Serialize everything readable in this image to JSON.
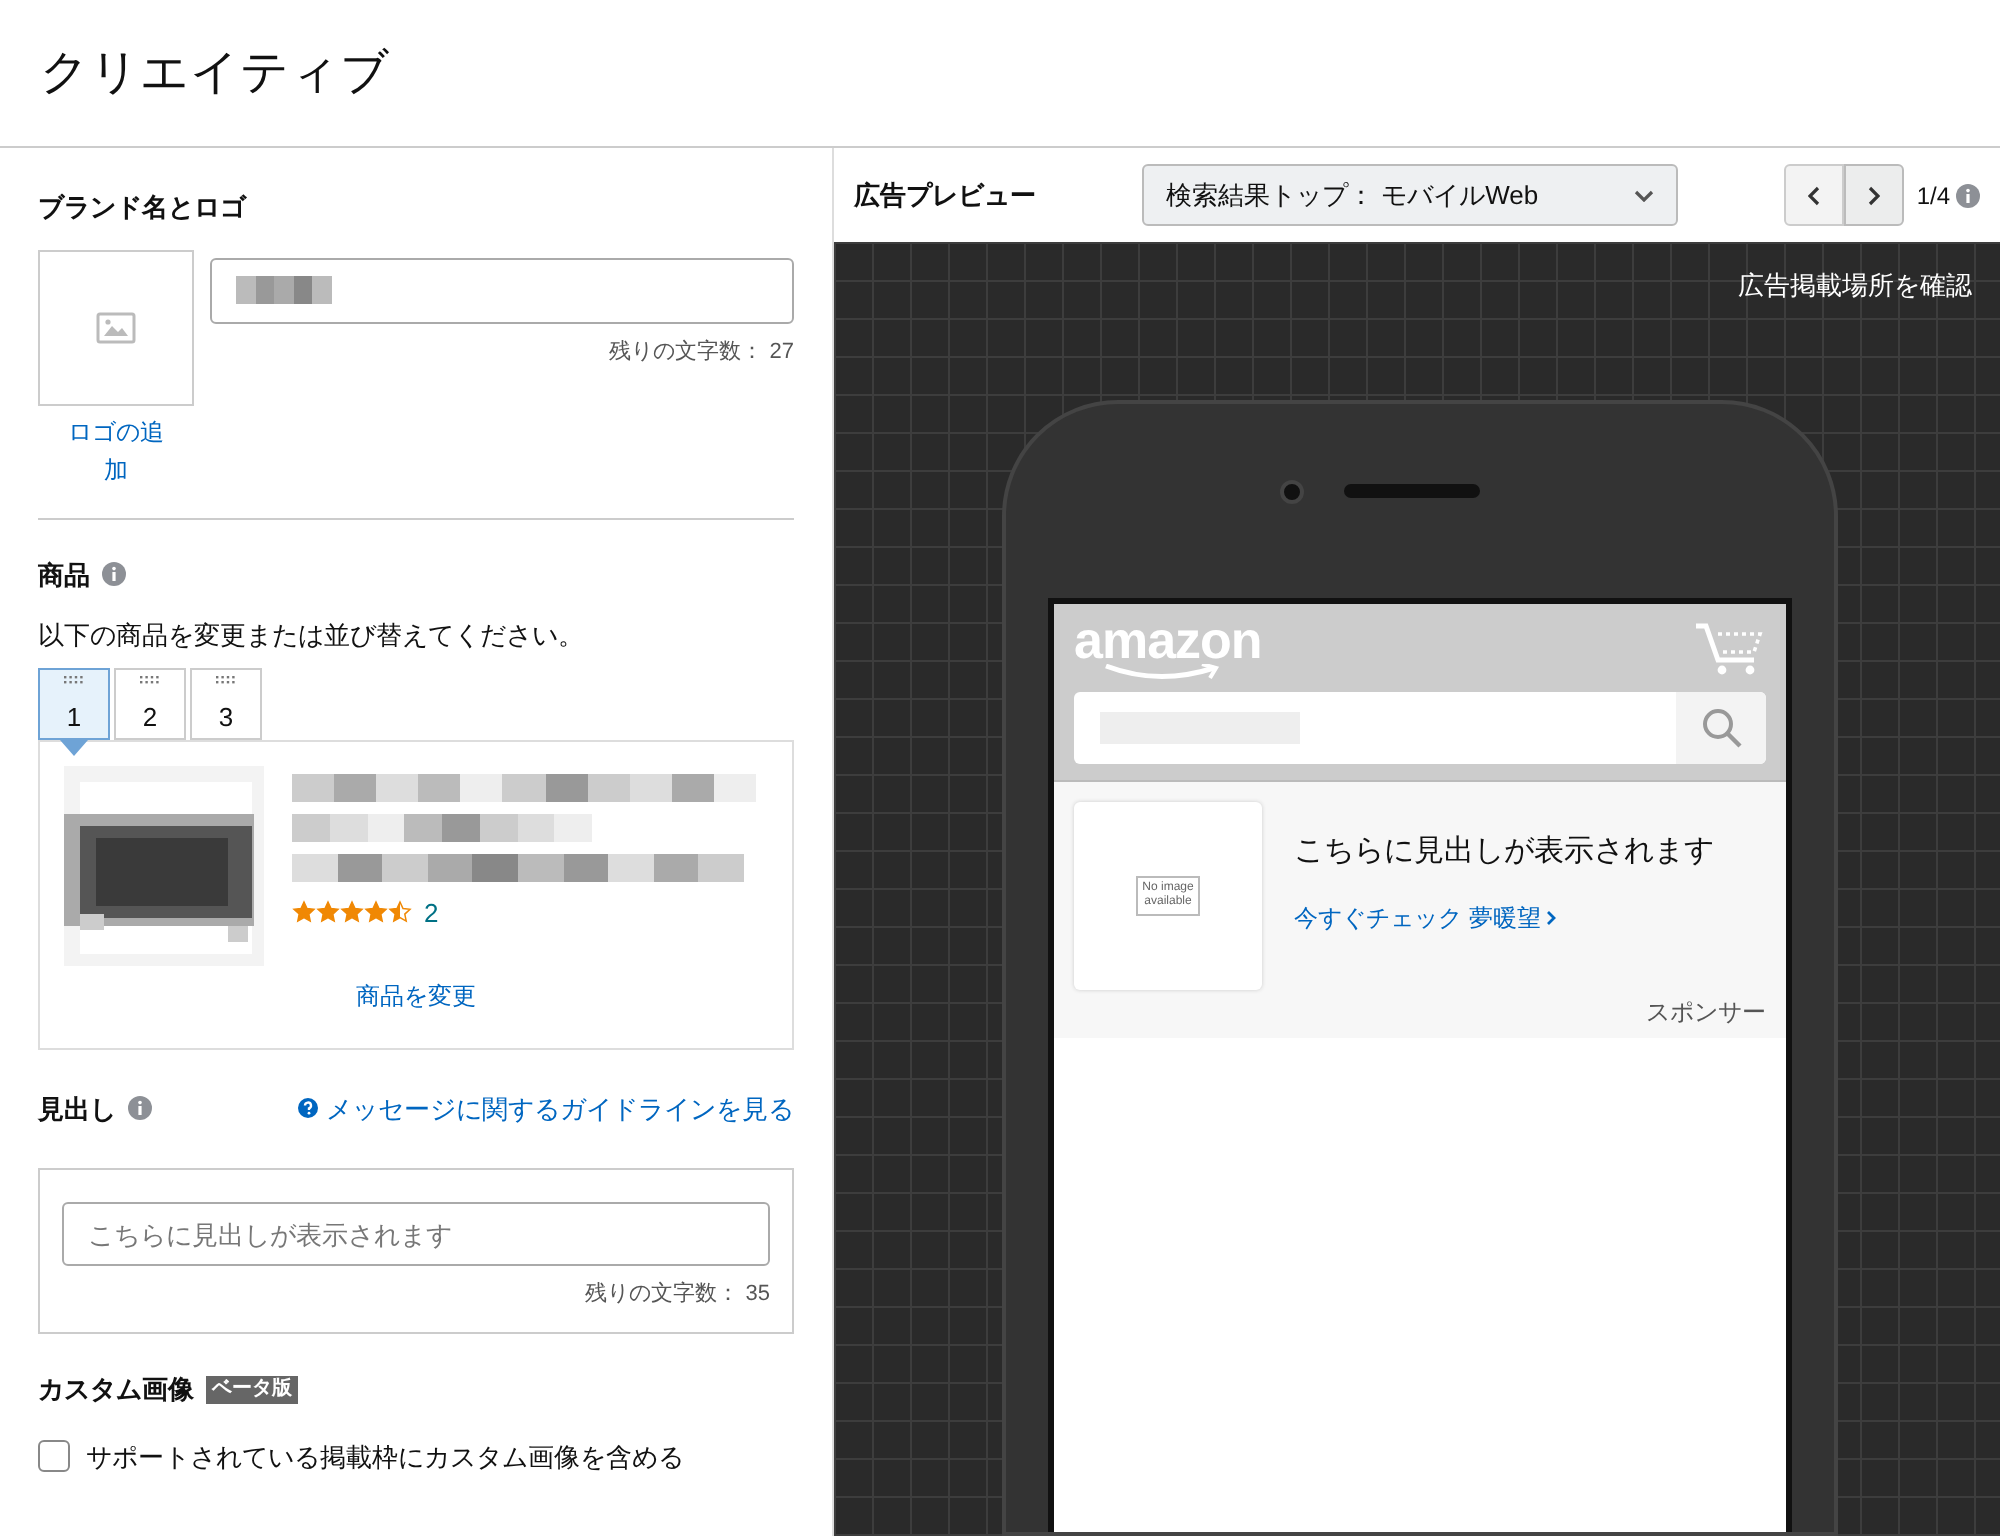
{
  "page_title": "クリエイティブ",
  "brand": {
    "heading": "ブランド名とロゴ",
    "add_logo": "ロゴの追加",
    "remaining": "残りの文字数： 27"
  },
  "products": {
    "heading": "商品",
    "instruction": "以下の商品を変更または並び替えてください。",
    "tabs": [
      {
        "label": "1",
        "selected": true
      },
      {
        "label": "2",
        "selected": false
      },
      {
        "label": "3",
        "selected": false
      }
    ],
    "stars": 4.5,
    "review_count": "2",
    "change_link": "商品を変更"
  },
  "headline": {
    "heading": "見出し",
    "guideline_link": "メッセージに関するガイドラインを見る",
    "placeholder": "こちらに見出しが表示されます",
    "remaining": "残りの文字数： 35"
  },
  "custom_image": {
    "heading": "カスタム画像",
    "badge": "ベータ版",
    "option": "サポートされている掲載枠にカスタム画像を含める",
    "checked": false
  },
  "preview": {
    "heading": "広告プレビュー",
    "placement": "検索結果トップ： モバイルWeb",
    "pager": "1/4",
    "placement_link": "広告掲載場所を確認",
    "phone": {
      "logo": "amazon",
      "no_image": "No image available",
      "headline": "こちらに見出しが表示されます",
      "cta": "今すぐチェック 夢暖望",
      "sponsored": "スポンサー"
    }
  }
}
